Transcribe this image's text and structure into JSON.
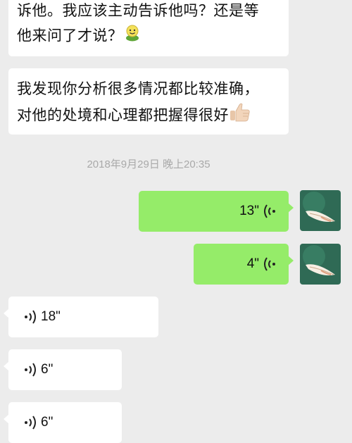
{
  "messages": {
    "m1": {
      "line1": "诉他。我应该主动告诉他吗？还是等",
      "line2": "他来问了才说？",
      "emoji": "green-smile-emoji"
    },
    "m2": {
      "line1": "我发现你分析很多情况都比较准确，",
      "line2": "对他的处境和心理都把握得很好",
      "emoji": "thumbs-up-emoji"
    },
    "timestamp": "2018年9月29日 晚上20:35",
    "voice_sent": [
      {
        "duration": "13\""
      },
      {
        "duration": "4\""
      }
    ],
    "voice_received": [
      {
        "duration": "18\""
      },
      {
        "duration": "6\""
      },
      {
        "duration": "6\""
      }
    ]
  },
  "colors": {
    "background": "#ececec",
    "sent_bubble": "#95ec69",
    "received_bubble": "#ffffff"
  },
  "icons": {
    "voice": "voice-wave-icon",
    "avatar": "avatar-feather-icon"
  }
}
